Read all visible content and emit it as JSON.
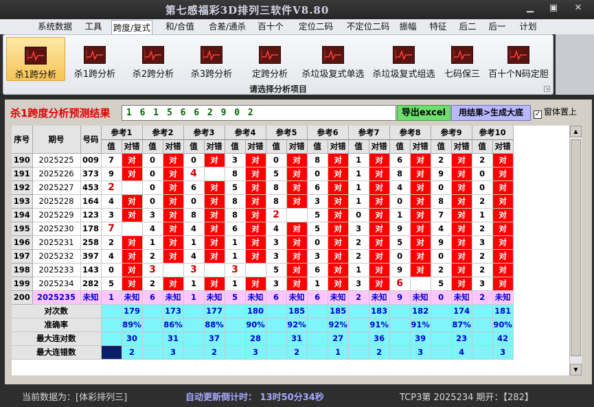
{
  "app": {
    "title": "第七感福彩3D排列三软件V8.80"
  },
  "menu": [
    "系统数据",
    "工具",
    "跨度/复式",
    "和/合值",
    "合差/通杀",
    "百十个",
    "定位二码",
    "不定位二码",
    "振幅",
    "特征",
    "后二",
    "后一",
    "计划"
  ],
  "menu_active_index": 2,
  "ribbon": {
    "buttons": [
      "杀1跨分析",
      "杀1跨分析",
      "杀2跨分析",
      "杀3跨分析",
      "定跨分析",
      "杀垃圾复式单选",
      "杀垃圾复式组选",
      "七码保三",
      "百十个N码定胆"
    ],
    "active_index": 0,
    "group_label": "请选择分析项目"
  },
  "result": {
    "title": "杀1跨度分析预测结果",
    "digits": "1 6 1 5 6 6 2 9 0 2",
    "export_label": "导出excel",
    "generate_label": "用结果>生成大底",
    "pin_label": "窗体置上",
    "pin_checked": "✓"
  },
  "table": {
    "col_seq": "序号",
    "col_period": "期号",
    "col_number": "号码",
    "ref_headers": [
      "参考1",
      "参考2",
      "参考3",
      "参考4",
      "参考5",
      "参考6",
      "参考7",
      "参考8",
      "参考9",
      "参考10"
    ],
    "sub_value": "值",
    "sub_check": "对错",
    "ok_text": "对",
    "rows": [
      {
        "seq": "190",
        "period": "2025225",
        "num": "009",
        "refs": [
          [
            "7",
            1
          ],
          [
            "0",
            1
          ],
          [
            "0",
            1
          ],
          [
            "3",
            1
          ],
          [
            "0",
            1
          ],
          [
            "8",
            1
          ],
          [
            "1",
            1
          ],
          [
            "6",
            1
          ],
          [
            "2",
            1
          ],
          [
            "2",
            1
          ]
        ]
      },
      {
        "seq": "191",
        "period": "2025226",
        "num": "373",
        "refs": [
          [
            "9",
            1
          ],
          [
            "0",
            1
          ],
          [
            "4",
            0
          ],
          [
            "8",
            1
          ],
          [
            "5",
            1
          ],
          [
            "0",
            1
          ],
          [
            "1",
            1
          ],
          [
            "8",
            1
          ],
          [
            "9",
            1
          ],
          [
            "0",
            1
          ]
        ]
      },
      {
        "seq": "192",
        "period": "2025227",
        "num": "453",
        "refs": [
          [
            "2",
            0
          ],
          [
            "0",
            1
          ],
          [
            "6",
            1
          ],
          [
            "5",
            1
          ],
          [
            "8",
            1
          ],
          [
            "6",
            1
          ],
          [
            "1",
            1
          ],
          [
            "4",
            1
          ],
          [
            "0",
            1
          ],
          [
            "0",
            1
          ]
        ]
      },
      {
        "seq": "193",
        "period": "2025228",
        "num": "164",
        "refs": [
          [
            "4",
            1
          ],
          [
            "0",
            1
          ],
          [
            "0",
            1
          ],
          [
            "8",
            1
          ],
          [
            "8",
            1
          ],
          [
            "3",
            1
          ],
          [
            "1",
            1
          ],
          [
            "0",
            1
          ],
          [
            "8",
            1
          ],
          [
            "2",
            1
          ]
        ]
      },
      {
        "seq": "194",
        "period": "2025229",
        "num": "123",
        "refs": [
          [
            "3",
            1
          ],
          [
            "3",
            1
          ],
          [
            "8",
            1
          ],
          [
            "8",
            1
          ],
          [
            "2",
            0
          ],
          [
            "5",
            1
          ],
          [
            "0",
            1
          ],
          [
            "1",
            1
          ],
          [
            "7",
            1
          ],
          [
            "1",
            1
          ]
        ]
      },
      {
        "seq": "195",
        "period": "2025230",
        "num": "178",
        "refs": [
          [
            "7",
            0
          ],
          [
            "4",
            1
          ],
          [
            "4",
            1
          ],
          [
            "6",
            1
          ],
          [
            "4",
            1
          ],
          [
            "5",
            1
          ],
          [
            "3",
            1
          ],
          [
            "9",
            1
          ],
          [
            "4",
            1
          ],
          [
            "2",
            1
          ]
        ]
      },
      {
        "seq": "196",
        "period": "2025231",
        "num": "258",
        "refs": [
          [
            "2",
            1
          ],
          [
            "1",
            1
          ],
          [
            "1",
            1
          ],
          [
            "1",
            1
          ],
          [
            "3",
            1
          ],
          [
            "0",
            1
          ],
          [
            "2",
            1
          ],
          [
            "5",
            1
          ],
          [
            "9",
            1
          ],
          [
            "3",
            1
          ]
        ]
      },
      {
        "seq": "197",
        "period": "2025232",
        "num": "397",
        "refs": [
          [
            "4",
            1
          ],
          [
            "2",
            1
          ],
          [
            "4",
            1
          ],
          [
            "1",
            1
          ],
          [
            "3",
            1
          ],
          [
            "3",
            1
          ],
          [
            "2",
            1
          ],
          [
            "0",
            1
          ],
          [
            "0",
            1
          ],
          [
            "2",
            1
          ]
        ]
      },
      {
        "seq": "198",
        "period": "2025233",
        "num": "143",
        "refs": [
          [
            "0",
            1
          ],
          [
            "3",
            0
          ],
          [
            "3",
            0
          ],
          [
            "3",
            0
          ],
          [
            "5",
            1
          ],
          [
            "6",
            1
          ],
          [
            "1",
            1
          ],
          [
            "9",
            1
          ],
          [
            "2",
            1
          ],
          [
            "2",
            1
          ]
        ]
      },
      {
        "seq": "199",
        "period": "2025234",
        "num": "282",
        "refs": [
          [
            "5",
            1
          ],
          [
            "2",
            1
          ],
          [
            "1",
            1
          ],
          [
            "1",
            1
          ],
          [
            "3",
            1
          ],
          [
            "1",
            1
          ],
          [
            "3",
            1
          ],
          [
            "6",
            0
          ],
          [
            "5",
            1
          ],
          [
            "3",
            1
          ]
        ]
      }
    ],
    "predict": {
      "seq": "200",
      "period": "2025235",
      "num": "未知",
      "values": [
        "1",
        "6",
        "1",
        "5",
        "6",
        "6",
        "2",
        "9",
        "0",
        "2"
      ],
      "unknown": "未知"
    },
    "stats": [
      {
        "label": "对次数",
        "values": [
          "179",
          "173",
          "177",
          "180",
          "185",
          "185",
          "183",
          "182",
          "174",
          "181"
        ]
      },
      {
        "label": "准确率",
        "values": [
          "89%",
          "86%",
          "88%",
          "90%",
          "92%",
          "92%",
          "91%",
          "91%",
          "87%",
          "90%"
        ]
      },
      {
        "label": "最大连对数",
        "values": [
          "30",
          "31",
          "37",
          "28",
          "31",
          "27",
          "36",
          "39",
          "23",
          "42"
        ]
      },
      {
        "label": "最大连错数",
        "values": [
          "2",
          "3",
          "2",
          "3",
          "2",
          "1",
          "2",
          "3",
          "4",
          "3"
        ]
      }
    ]
  },
  "status": {
    "data_label": "当前数据为：[体彩排列三]",
    "countdown": "自动更新倒计时：  13时50分34秒",
    "last_draw": "TCP3第  2025234  期开：【282】"
  }
}
